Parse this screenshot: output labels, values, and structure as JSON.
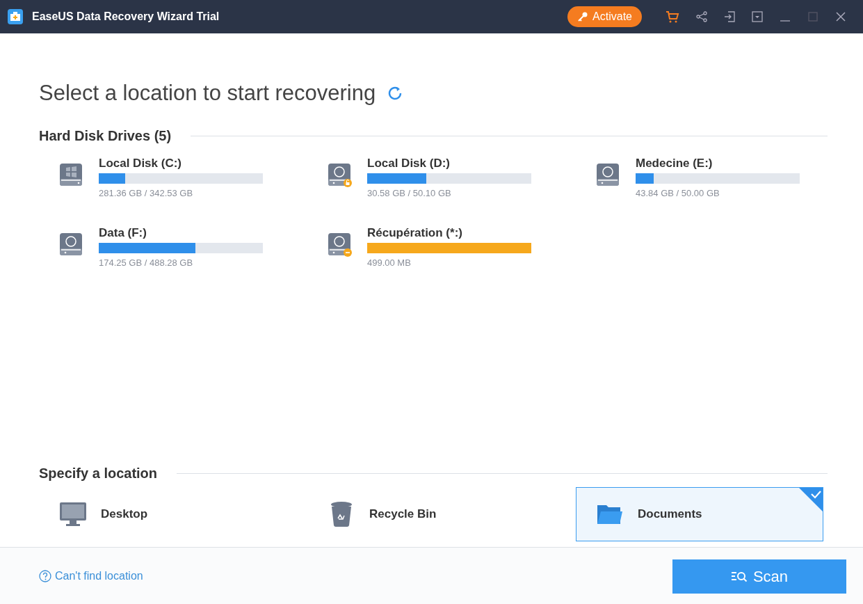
{
  "window": {
    "title": "EaseUS Data Recovery Wizard Trial",
    "activate_button": "Activate"
  },
  "heading": "Select a location to start recovering",
  "hard_disk_drives": {
    "title": "Hard Disk Drives (5)",
    "drives": [
      {
        "name": "Local Disk (C:)",
        "kind": "system",
        "level": 0.16,
        "color": "#2f8fea",
        "size": "281.36 GB / 342.53 GB"
      },
      {
        "name": "Local Disk (D:)",
        "kind": "locked",
        "level": 0.36,
        "color": "#2f8fea",
        "size": "30.58 GB / 50.10 GB"
      },
      {
        "name": "Medecine (E:)",
        "kind": "plain",
        "level": 0.11,
        "color": "#2f8fea",
        "size": "43.84 GB / 50.00 GB"
      },
      {
        "name": "Data (F:)",
        "kind": "plain",
        "level": 0.59,
        "color": "#2f8fea",
        "size": "174.25 GB / 488.28 GB"
      },
      {
        "name": "Récupération (*:)",
        "kind": "minus",
        "level": 1,
        "color": "#f6a81c",
        "size": "499.00 MB"
      }
    ]
  },
  "specify_location": {
    "title": "Specify a location",
    "locations": [
      {
        "name": "Desktop",
        "kind": "desktop",
        "selected": false
      },
      {
        "name": "Recycle Bin",
        "kind": "recycle",
        "selected": false
      },
      {
        "name": "Documents",
        "kind": "folder",
        "selected": true
      }
    ]
  },
  "footer": {
    "help_link": "Can't find location",
    "scan_button": "Scan"
  }
}
